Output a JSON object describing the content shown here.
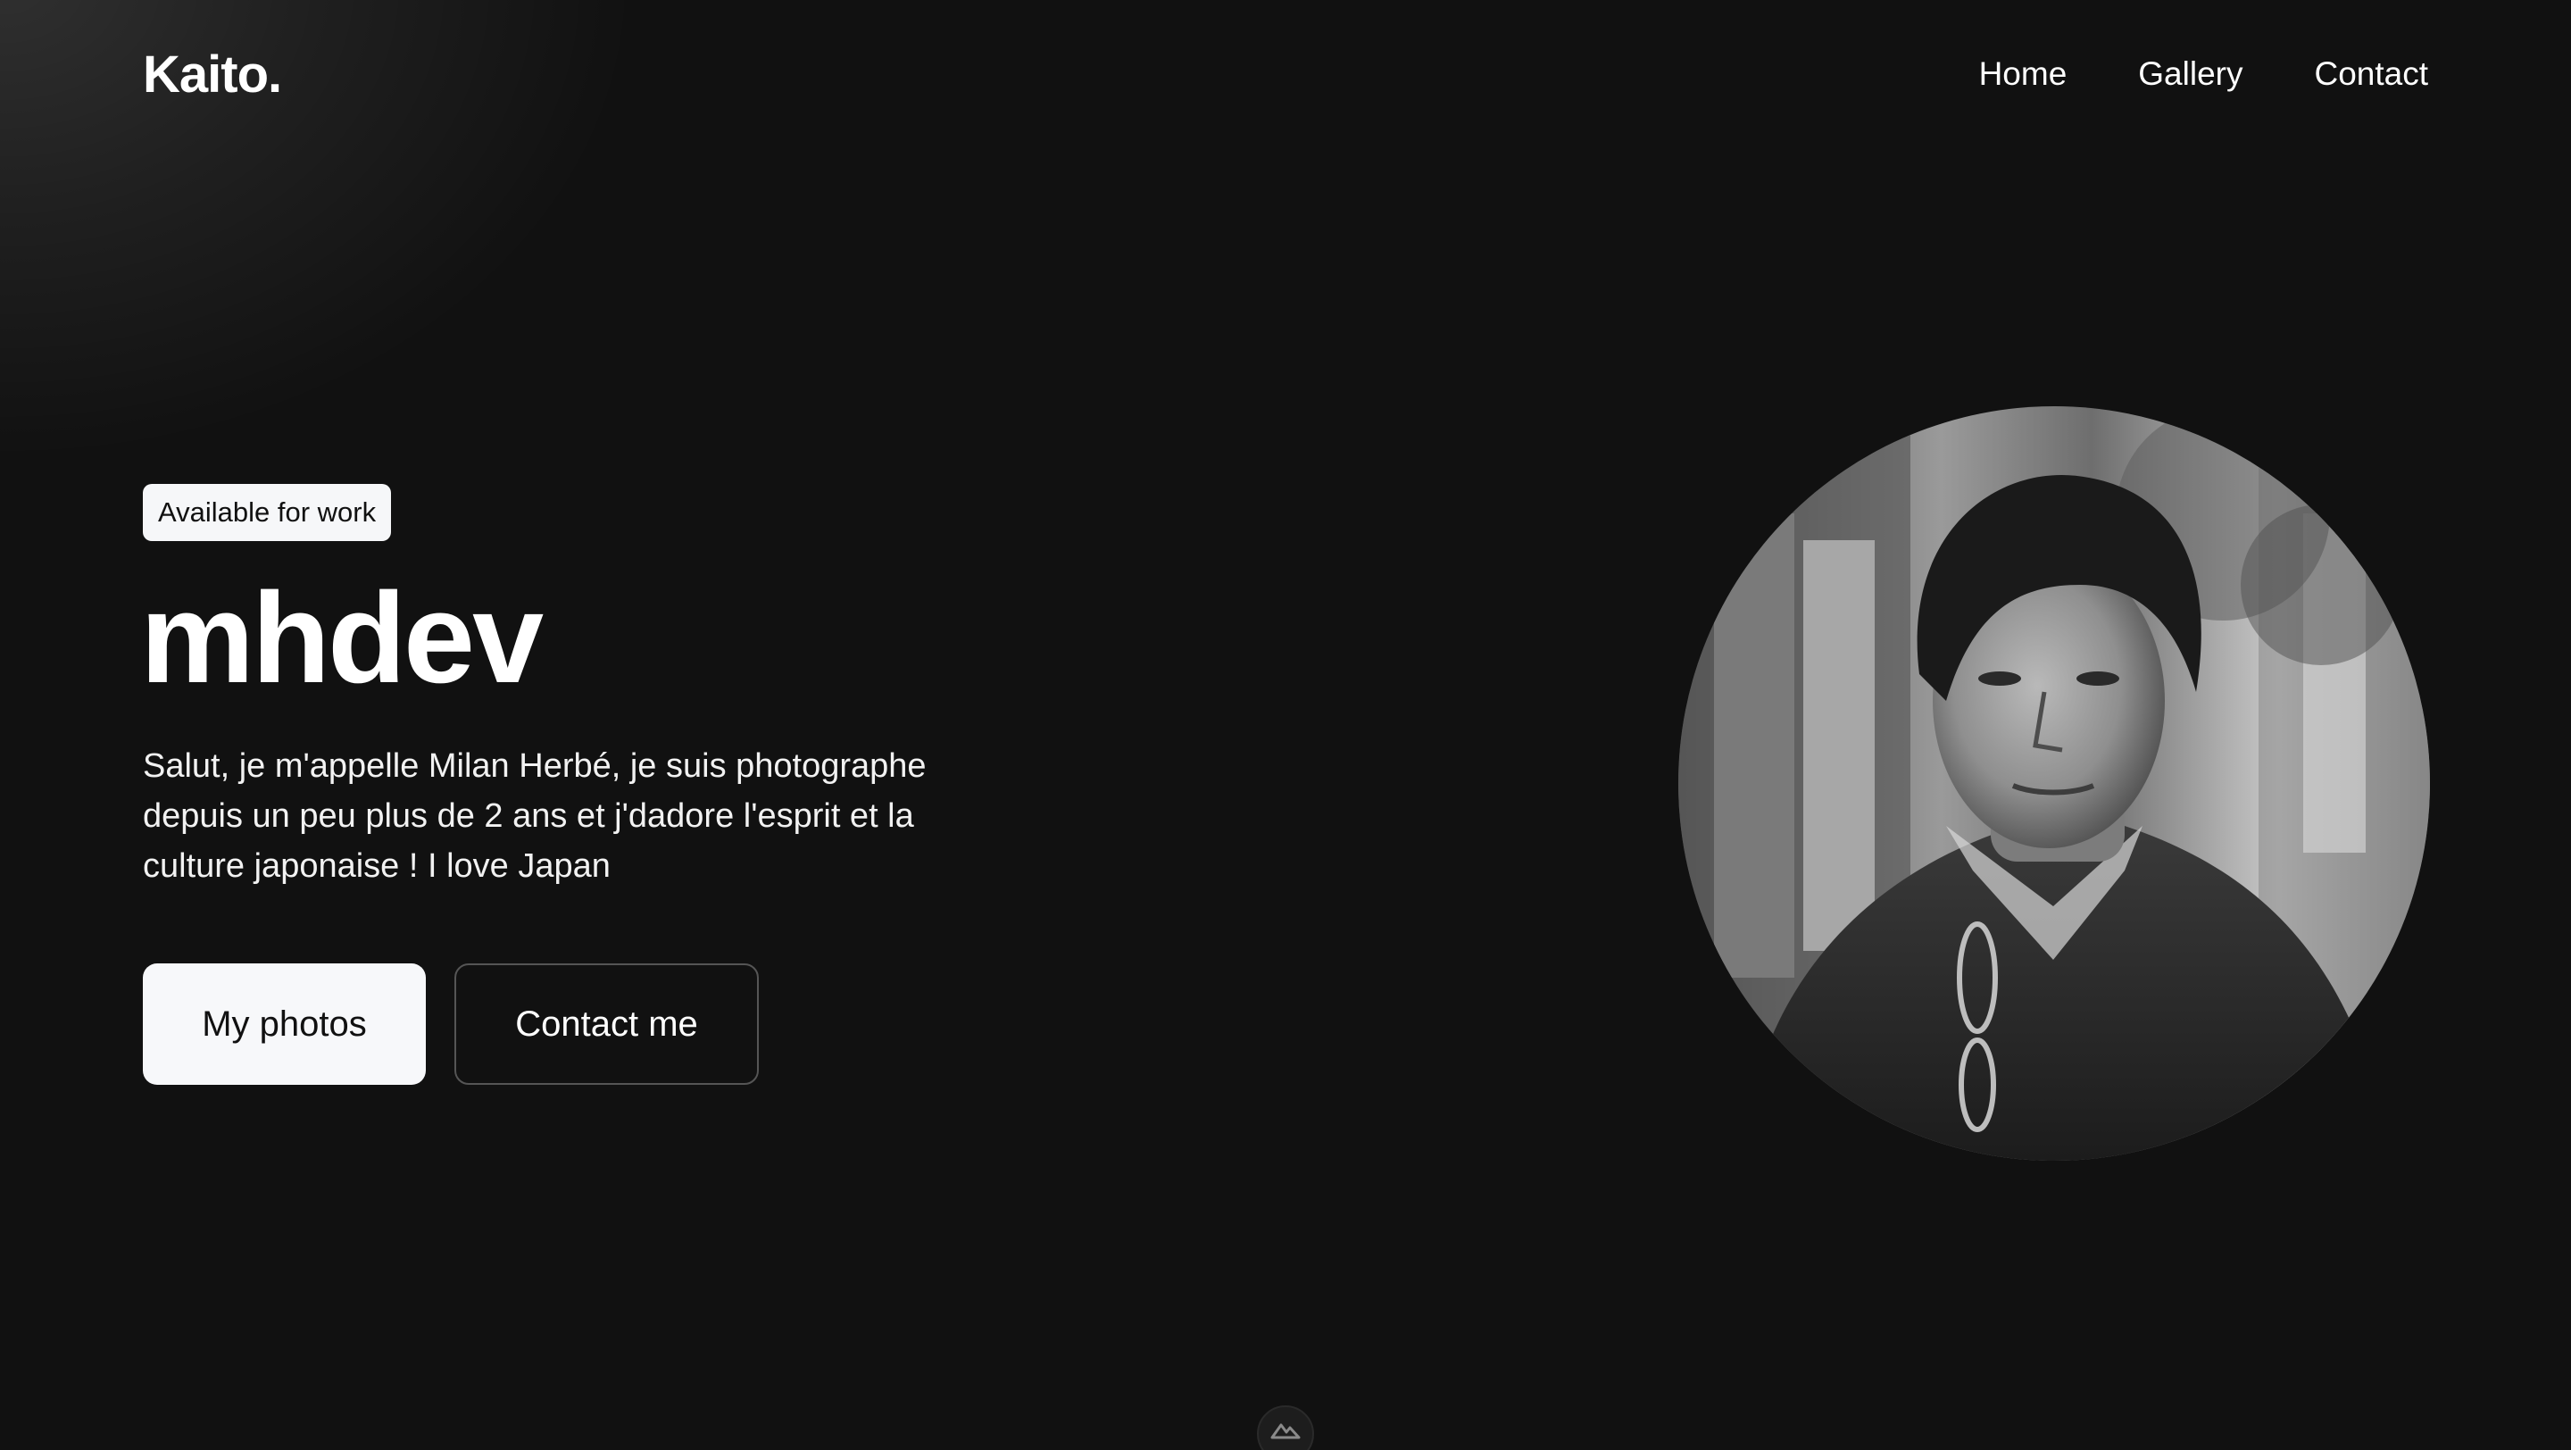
{
  "header": {
    "logo": "Kaito.",
    "nav": [
      {
        "label": "Home"
      },
      {
        "label": "Gallery"
      },
      {
        "label": "Contact"
      }
    ]
  },
  "hero": {
    "badge": "Available for work",
    "title": "mhdev",
    "text": "Salut, je m'appelle Milan Herbé, je suis photographe depuis un peu plus de 2 ans et j'dadore l'esprit et la culture japonaise ! I love Japan",
    "primary_button": "My photos",
    "secondary_button": "Contact me"
  },
  "portrait": {
    "style": "black-and-white street portrait in a narrow alley"
  },
  "icons": {
    "scroll_marker": "mountain-icon"
  },
  "colors": {
    "background": "#111111",
    "text": "#ffffff",
    "button_light": "#f7f8fa"
  }
}
